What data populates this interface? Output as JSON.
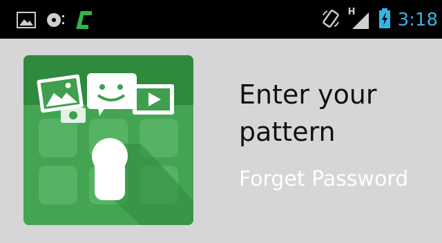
{
  "status_bar": {
    "clock": "3:18",
    "network_label": "H",
    "left_icons": [
      "gallery-icon",
      "media-icon",
      "c-app-icon"
    ],
    "right_icons": [
      "rotate-icon",
      "signal-icon",
      "battery-icon"
    ],
    "clock_color": "#33b5e5"
  },
  "lock_screen": {
    "title": "Enter your pattern",
    "forget_password_label": "Forget Password"
  },
  "colors": {
    "background": "#d6d6d6",
    "tile_green": "#3f9f4e",
    "tile_dark_green": "#2e8a3d"
  }
}
